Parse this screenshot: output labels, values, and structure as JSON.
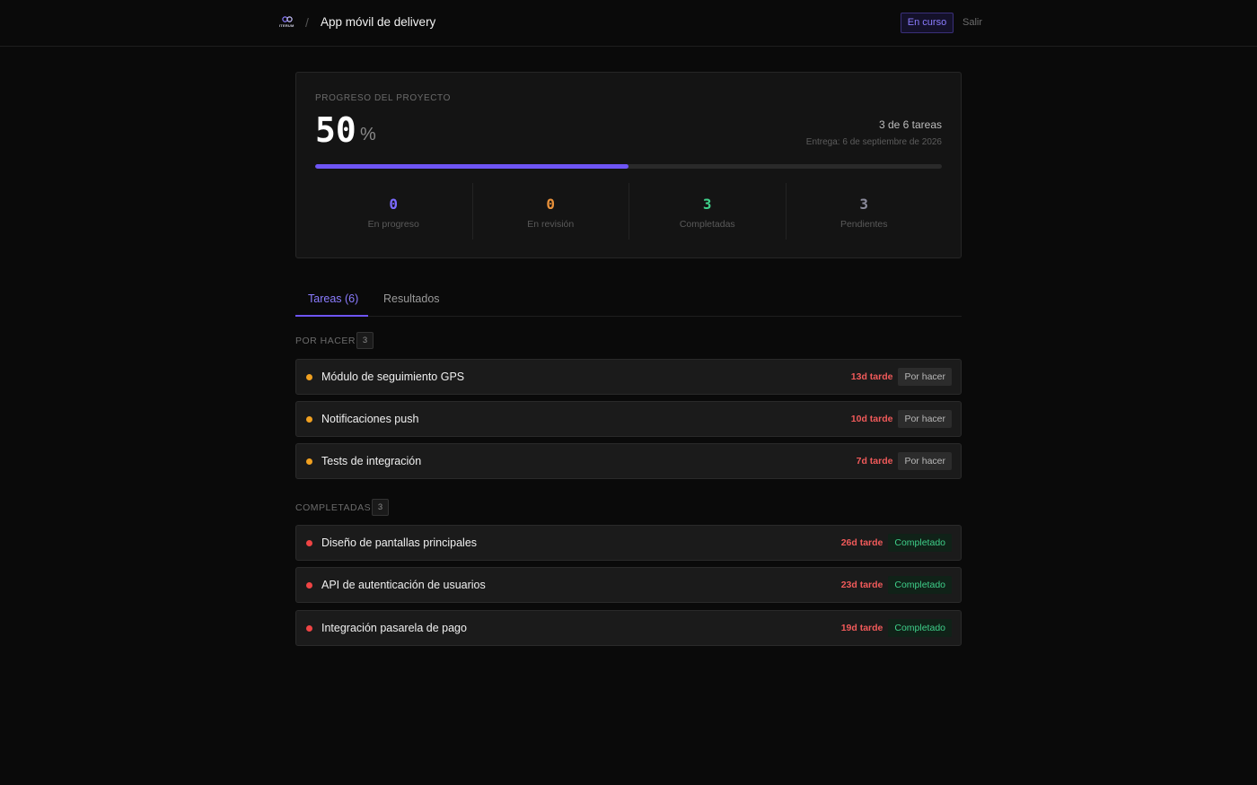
{
  "header": {
    "logo_text": "ITERUM",
    "separator": "/",
    "project_title": "App móvil de delivery",
    "status": "En curso",
    "logout": "Salir"
  },
  "progress": {
    "label": "PROGRESO DEL PROYECTO",
    "percent": "50",
    "percent_sign": "%",
    "fraction": 0.5,
    "tasks_count": "3 de 6 tareas",
    "due_date": "Entrega: 6 de septiembre de 2026",
    "accent_color": "#6e55f5",
    "stats": [
      {
        "value": "0",
        "label": "En progreso",
        "color": "#7c6bff"
      },
      {
        "value": "0",
        "label": "En revisión",
        "color": "#e9913a"
      },
      {
        "value": "3",
        "label": "Completadas",
        "color": "#3fd08a"
      },
      {
        "value": "3",
        "label": "Pendientes",
        "color": "#8a8a9a"
      }
    ]
  },
  "tabs": [
    {
      "label": "Tareas (6)",
      "active": true
    },
    {
      "label": "Resultados",
      "active": false
    }
  ],
  "sections": {
    "todo": {
      "title": "POR HACER",
      "count": "3",
      "tasks": [
        {
          "title": "Módulo de seguimiento GPS",
          "late": "13d tarde",
          "status": "Por hacer",
          "dot_color": "#f0a020"
        },
        {
          "title": "Notificaciones push",
          "late": "10d tarde",
          "status": "Por hacer",
          "dot_color": "#f0a020"
        },
        {
          "title": "Tests de integración",
          "late": "7d tarde",
          "status": "Por hacer",
          "dot_color": "#f0a020"
        }
      ]
    },
    "done": {
      "title": "COMPLETADAS",
      "count": "3",
      "tasks": [
        {
          "title": "Diseño de pantallas principales",
          "late": "26d tarde",
          "status": "Completado",
          "dot_color": "#ef4444"
        },
        {
          "title": "API de autenticación de usuarios",
          "late": "23d tarde",
          "status": "Completado",
          "dot_color": "#ef4444"
        },
        {
          "title": "Integración pasarela de pago",
          "late": "19d tarde",
          "status": "Completado",
          "dot_color": "#ef4444"
        }
      ]
    }
  }
}
